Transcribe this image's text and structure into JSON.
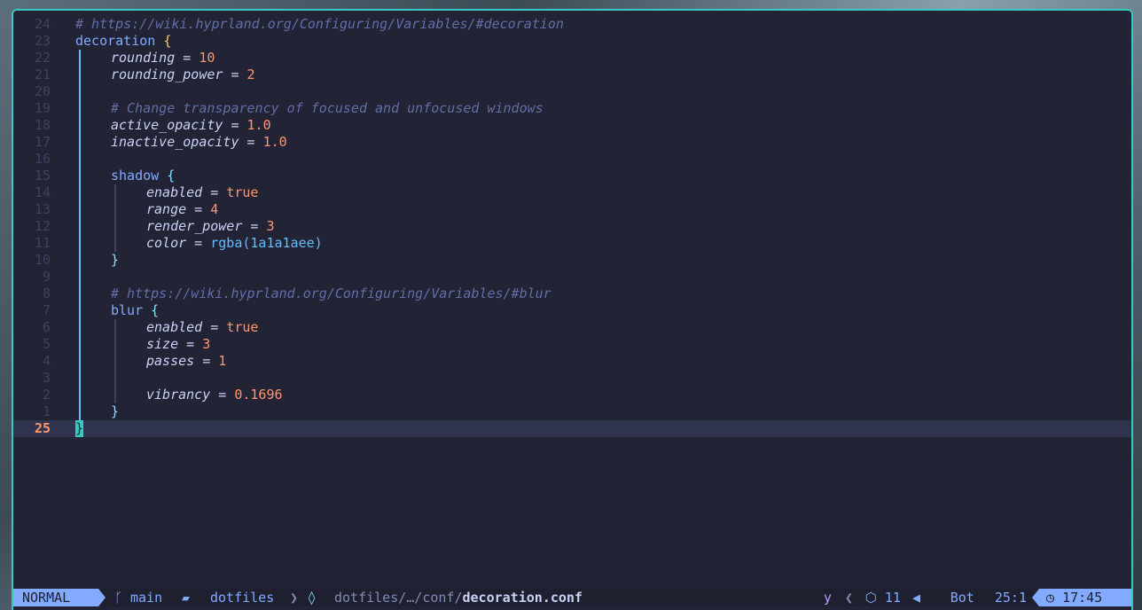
{
  "editor": {
    "lines": [
      {
        "num": "24",
        "segments": [
          {
            "c": "cmt",
            "t": "# https://wiki.hyprland.org/Configuring/Variables/#decoration"
          }
        ],
        "indent": 0
      },
      {
        "num": "23",
        "segments": [
          {
            "c": "kw",
            "t": "decoration"
          },
          {
            "c": "op",
            "t": " "
          },
          {
            "c": "brace",
            "t": "{"
          }
        ],
        "indent": 0
      },
      {
        "num": "22",
        "segments": [
          {
            "c": "var",
            "t": "rounding"
          },
          {
            "c": "op",
            "t": " = "
          },
          {
            "c": "num",
            "t": "10"
          }
        ],
        "indent": 1
      },
      {
        "num": "21",
        "segments": [
          {
            "c": "var",
            "t": "rounding_power"
          },
          {
            "c": "op",
            "t": " = "
          },
          {
            "c": "num",
            "t": "2"
          }
        ],
        "indent": 1
      },
      {
        "num": "20",
        "segments": [],
        "indent": 1
      },
      {
        "num": "19",
        "segments": [
          {
            "c": "cmt",
            "t": "# Change transparency of focused and unfocused windows"
          }
        ],
        "indent": 1
      },
      {
        "num": "18",
        "segments": [
          {
            "c": "var",
            "t": "active_opacity"
          },
          {
            "c": "op",
            "t": " = "
          },
          {
            "c": "num",
            "t": "1.0"
          }
        ],
        "indent": 1
      },
      {
        "num": "17",
        "segments": [
          {
            "c": "var",
            "t": "inactive_opacity"
          },
          {
            "c": "op",
            "t": " = "
          },
          {
            "c": "num",
            "t": "1.0"
          }
        ],
        "indent": 1
      },
      {
        "num": "16",
        "segments": [],
        "indent": 1
      },
      {
        "num": "15",
        "segments": [
          {
            "c": "kw",
            "t": "shadow"
          },
          {
            "c": "op",
            "t": " "
          },
          {
            "c": "brace2",
            "t": "{"
          }
        ],
        "indent": 1
      },
      {
        "num": "14",
        "segments": [
          {
            "c": "var",
            "t": "enabled"
          },
          {
            "c": "op",
            "t": " = "
          },
          {
            "c": "bool",
            "t": "true"
          }
        ],
        "indent": 2
      },
      {
        "num": "13",
        "segments": [
          {
            "c": "var",
            "t": "range"
          },
          {
            "c": "op",
            "t": " = "
          },
          {
            "c": "num",
            "t": "4"
          }
        ],
        "indent": 2
      },
      {
        "num": "12",
        "segments": [
          {
            "c": "var",
            "t": "render_power"
          },
          {
            "c": "op",
            "t": " = "
          },
          {
            "c": "num",
            "t": "3"
          }
        ],
        "indent": 2
      },
      {
        "num": "11",
        "segments": [
          {
            "c": "var",
            "t": "color"
          },
          {
            "c": "op",
            "t": " = "
          },
          {
            "c": "fn",
            "t": "rgba(1a1a1aee)"
          }
        ],
        "indent": 2
      },
      {
        "num": "10",
        "segments": [
          {
            "c": "brace2",
            "t": "}"
          }
        ],
        "indent": 1
      },
      {
        "num": "9",
        "segments": [],
        "indent": 1
      },
      {
        "num": "8",
        "segments": [
          {
            "c": "cmt",
            "t": "# https://wiki.hyprland.org/Configuring/Variables/#blur"
          }
        ],
        "indent": 1
      },
      {
        "num": "7",
        "segments": [
          {
            "c": "kw",
            "t": "blur"
          },
          {
            "c": "op",
            "t": " "
          },
          {
            "c": "brace2",
            "t": "{"
          }
        ],
        "indent": 1
      },
      {
        "num": "6",
        "segments": [
          {
            "c": "var",
            "t": "enabled"
          },
          {
            "c": "op",
            "t": " = "
          },
          {
            "c": "bool",
            "t": "true"
          }
        ],
        "indent": 2
      },
      {
        "num": "5",
        "segments": [
          {
            "c": "var",
            "t": "size"
          },
          {
            "c": "op",
            "t": " = "
          },
          {
            "c": "num",
            "t": "3"
          }
        ],
        "indent": 2
      },
      {
        "num": "4",
        "segments": [
          {
            "c": "var",
            "t": "passes"
          },
          {
            "c": "op",
            "t": " = "
          },
          {
            "c": "num",
            "t": "1"
          }
        ],
        "indent": 2
      },
      {
        "num": "3",
        "segments": [],
        "indent": 2
      },
      {
        "num": "2",
        "segments": [
          {
            "c": "var",
            "t": "vibrancy"
          },
          {
            "c": "op",
            "t": " = "
          },
          {
            "c": "num",
            "t": "0.1696"
          }
        ],
        "indent": 2
      },
      {
        "num": "1",
        "segments": [
          {
            "c": "brace2",
            "t": "}"
          }
        ],
        "indent": 1
      },
      {
        "num": "25",
        "segments": [
          {
            "c": "cursor",
            "t": "}"
          }
        ],
        "indent": 0,
        "current": true
      }
    ]
  },
  "statusline": {
    "mode": "NORMAL",
    "git_branch": "main",
    "git_icon": "branch-icon",
    "folder_icon": "folder-icon",
    "project": "dotfiles",
    "path_prefix": "dotfiles/…/conf/",
    "filename": "decoration.conf",
    "register": "y",
    "lsp_icon": "cube-icon",
    "lsp_count": "11",
    "scroll": "Bot",
    "cursor_pos": "25:1",
    "clock_icon": "clock-icon",
    "time": "17:45"
  },
  "colors": {
    "border": "#38c9c0",
    "background": "#222436",
    "accent": "#82aaff",
    "comment": "#636da6",
    "number": "#ff966c"
  }
}
